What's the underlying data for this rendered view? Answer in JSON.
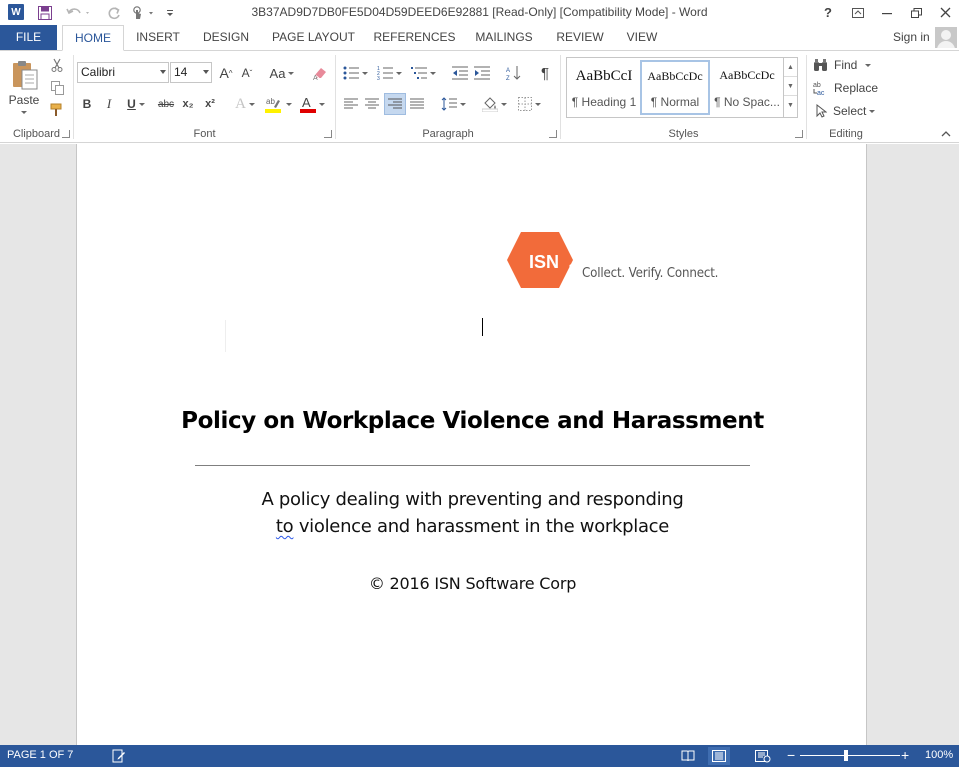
{
  "titlebar": {
    "app_icon_letter": "W",
    "title": "3B37AD9D7DB0FE5D04D59DEED6E92881 [Read-Only] [Compatibility Mode] - Word",
    "help_label": "?"
  },
  "tabs": [
    "FILE",
    "HOME",
    "INSERT",
    "DESIGN",
    "PAGE LAYOUT",
    "REFERENCES",
    "MAILINGS",
    "REVIEW",
    "VIEW"
  ],
  "signin_label": "Sign in",
  "clipboard": {
    "paste_label": "Paste",
    "group_label": "Clipboard"
  },
  "font": {
    "font_name": "Calibri",
    "font_size": "14",
    "change_case_label": "Aa",
    "group_label": "Font",
    "bold": "B",
    "italic": "I",
    "underline": "U",
    "strikethrough": "abc",
    "subscript": "x₂",
    "superscript": "x²"
  },
  "paragraph": {
    "group_label": "Paragraph",
    "show_marks": "¶"
  },
  "styles": {
    "group_label": "Styles",
    "items": [
      {
        "preview": "AaBbCcI",
        "caption": "¶ Heading 1"
      },
      {
        "preview": "AaBbCcDc",
        "caption": "¶ Normal"
      },
      {
        "preview": "AaBbCcDc",
        "caption": "¶ No Spac..."
      }
    ]
  },
  "editing": {
    "group_label": "Editing",
    "find_label": "Find",
    "replace_label": "Replace",
    "select_label": "Select"
  },
  "document": {
    "logo_text": "ISN",
    "tagline": "Collect. Verify. Connect.",
    "title": "Policy on Workplace Violence and Harassment",
    "subtitle_line1": "A policy dealing with preventing and responding",
    "subtitle_line2_word": "to",
    "subtitle_line2_rest": " violence and harassment in the workplace",
    "copyright": "© 2016 ISN Software Corp"
  },
  "statusbar": {
    "page_count": "PAGE 1 OF 7",
    "zoom_out": "−",
    "zoom_in": "+",
    "zoom_level": "100%"
  },
  "colors": {
    "accent": "#2b579a",
    "logo_orange": "#f26b3a"
  }
}
